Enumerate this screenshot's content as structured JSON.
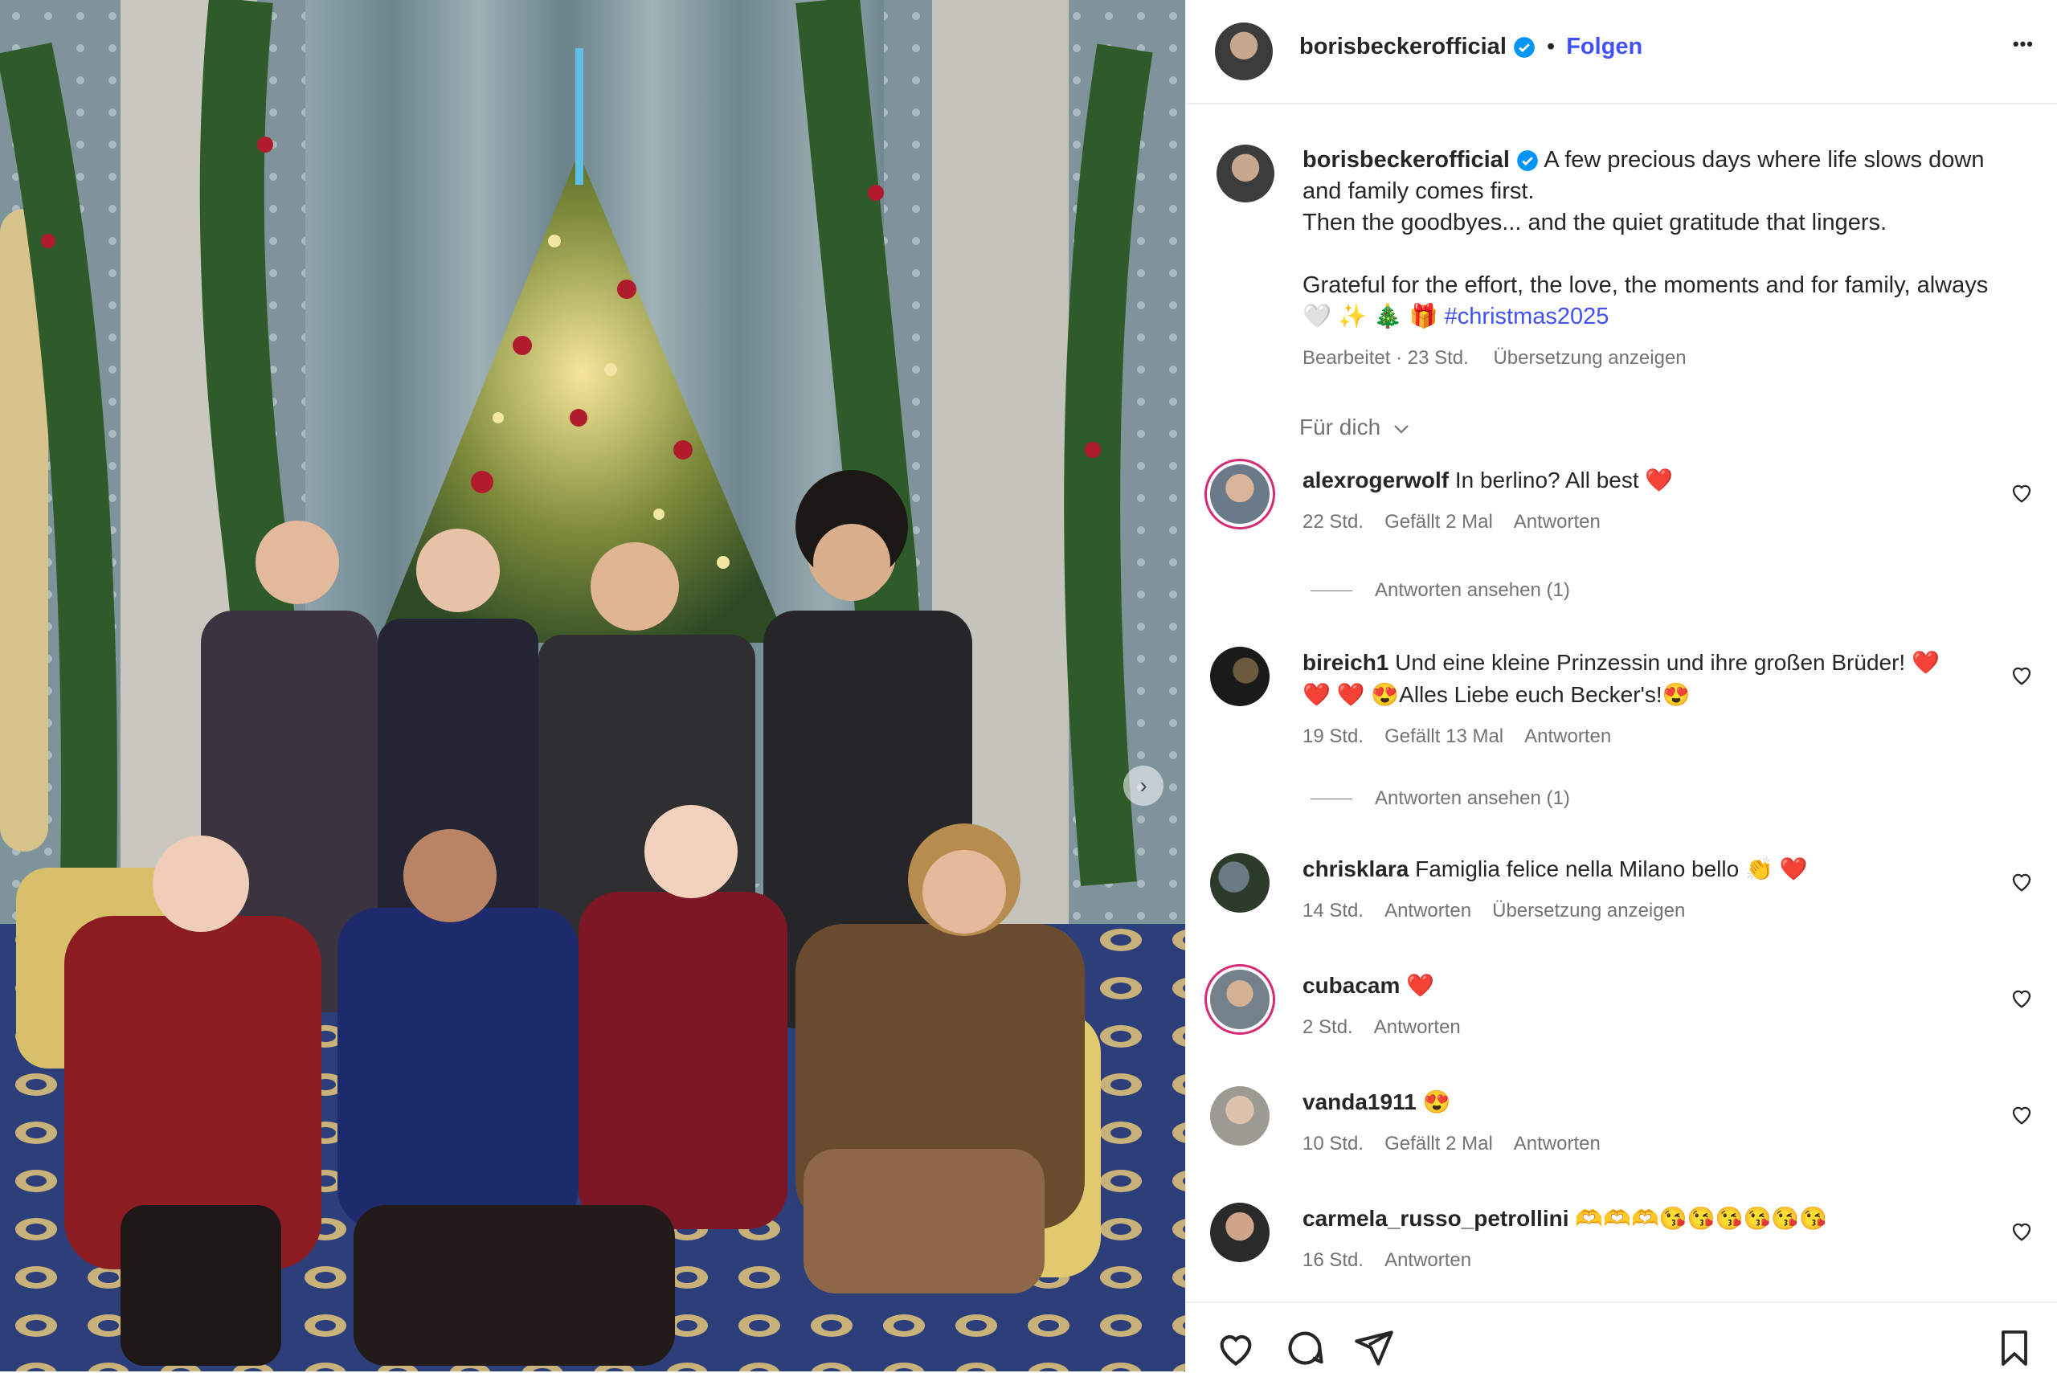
{
  "post": {
    "username": "borisbeckerofficial",
    "separator": "•",
    "follow_label": "Folgen",
    "more_label": "•••",
    "caption": {
      "line1": "A few precious days where life slows down",
      "line2": "and family comes first.",
      "line3": "Then the goodbyes... and the quiet gratitude that lingers.",
      "line4": "Grateful for the effort, the love, the moments and for family, always",
      "emojis": "🤍 ✨ 🎄 🎁",
      "hashtag": "#christmas2025"
    },
    "edited_label": "Bearbeitet · 23 Std.",
    "translate_label": "Übersetzung anzeigen",
    "sort_label": "Für dich"
  },
  "comments": [
    {
      "user": "alexrogerwolf",
      "text": "In berlino? All best ❤️",
      "time": "22 Std.",
      "likes": "Gefällt 2 Mal",
      "reply": "Antworten",
      "view_replies": "Antworten ansehen (1)"
    },
    {
      "user": "bireich1",
      "text": "Und eine kleine Prinzessin und ihre großen Brüder! ❤️ ❤️ ❤️ 😍Alles Liebe euch Becker's!😍",
      "time": "19 Std.",
      "likes": "Gefällt 13 Mal",
      "reply": "Antworten",
      "view_replies": "Antworten ansehen (1)"
    },
    {
      "user": "chrisklara",
      "text": "Famiglia felice nella Milano bello 👏 ❤️",
      "time": "14 Std.",
      "reply": "Antworten",
      "translate": "Übersetzung anzeigen"
    },
    {
      "user": "cubacam",
      "text": "❤️",
      "time": "2 Std.",
      "reply": "Antworten"
    },
    {
      "user": "vanda1911",
      "text": "😍",
      "time": "10 Std.",
      "likes": "Gefällt 2 Mal",
      "reply": "Antworten"
    },
    {
      "user": "carmela_russo_petrollini",
      "text": "🫶🫶🫶😘😘😘😘😘😘",
      "time": "16 Std.",
      "reply": "Antworten"
    }
  ],
  "colors": {
    "link_blue": "#4150f7",
    "verified_blue": "#0095f6",
    "heart_red": "#ff3040"
  }
}
